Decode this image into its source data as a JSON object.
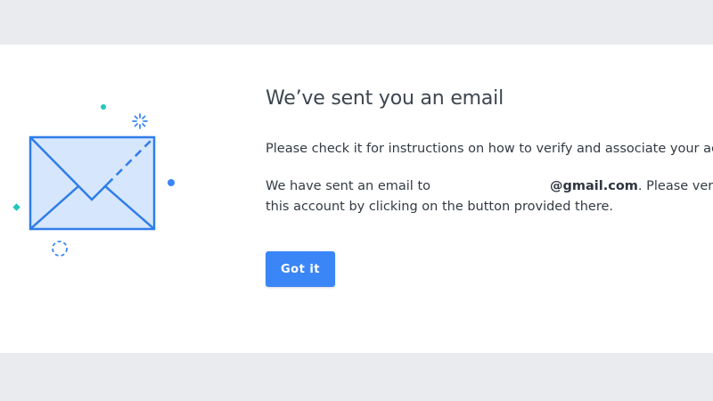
{
  "dialog": {
    "title": "We’ve sent you an email",
    "instructions": "Please check it for instructions on how to verify and associate your account.",
    "sent_prefix": "We have sent an email to",
    "email_domain": "@gmail.com",
    "sent_suffix": ". Please verify",
    "sent_line2": "this account by clicking on the button provided there.",
    "button_label": "Got it"
  },
  "illustration": {
    "icon": "envelope-icon"
  },
  "colors": {
    "page_background": "#e9ebee",
    "panel_background": "#ffffff",
    "accent_blue": "#3b86f7",
    "envelope_fill": "#d6e6fc",
    "envelope_stroke": "#2f7de9",
    "teal_dot": "#21c8b9",
    "text_dark": "#333a44"
  }
}
